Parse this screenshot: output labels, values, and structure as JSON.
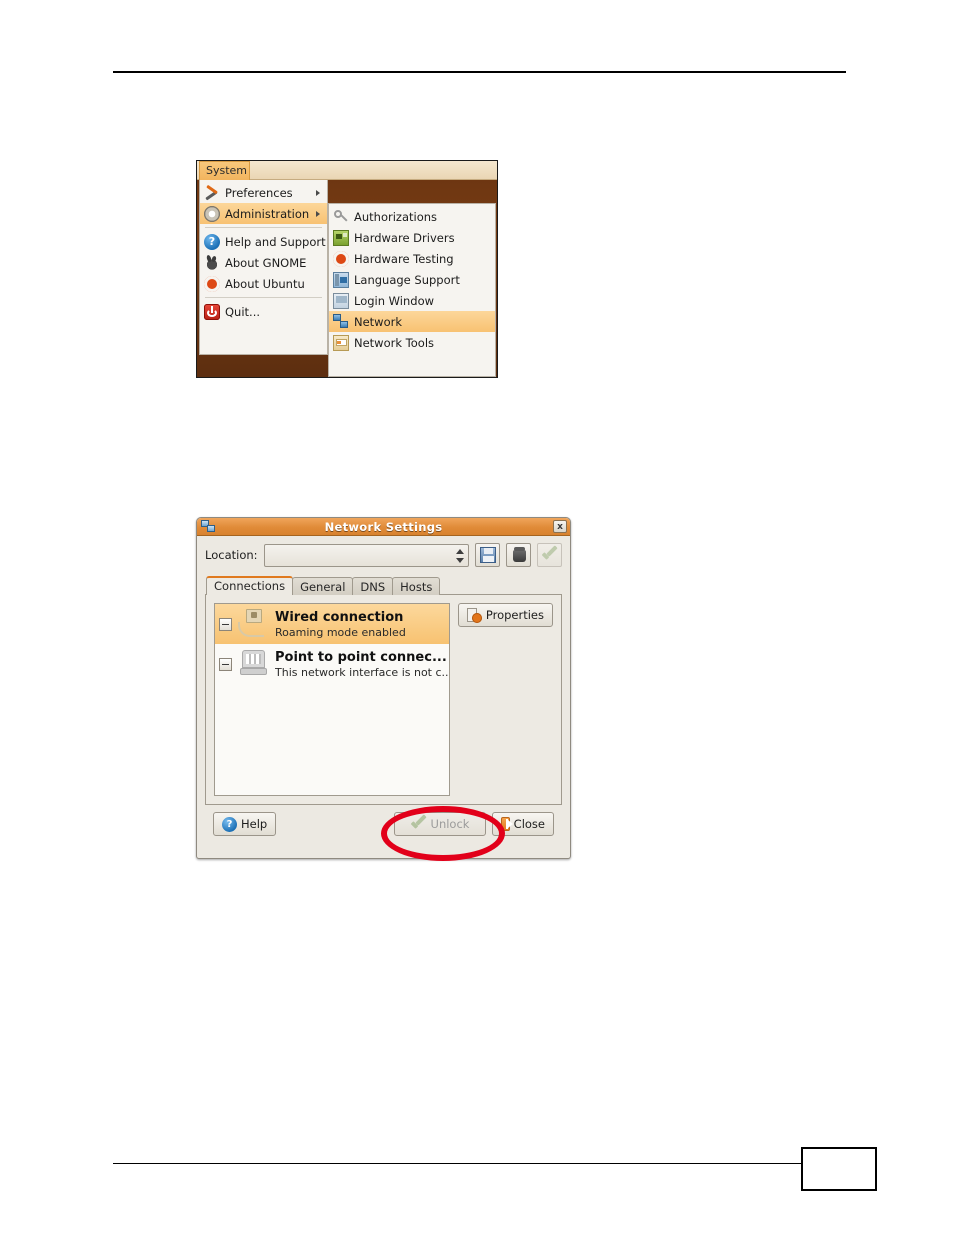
{
  "page": {
    "footer_page_number": ""
  },
  "system_menu": {
    "panel_button_label": "System",
    "primary_items": [
      {
        "label": "Preferences",
        "icon": "tools-icon",
        "has_submenu": true,
        "selected": false
      },
      {
        "label": "Administration",
        "icon": "gear-icon",
        "has_submenu": true,
        "selected": true
      },
      {
        "label": "Help and Support",
        "icon": "help-circle-icon",
        "has_submenu": false,
        "selected": false
      },
      {
        "label": "About GNOME",
        "icon": "gnome-foot-icon",
        "has_submenu": false,
        "selected": false
      },
      {
        "label": "About Ubuntu",
        "icon": "ubuntu-logo-icon",
        "has_submenu": false,
        "selected": false
      },
      {
        "label": "Quit...",
        "icon": "power-quit-icon",
        "has_submenu": false,
        "selected": false
      }
    ],
    "submenu_items": [
      {
        "label": "Authorizations",
        "icon": "key-icon",
        "selected": false
      },
      {
        "label": "Hardware Drivers",
        "icon": "hardware-drivers-icon",
        "selected": false
      },
      {
        "label": "Hardware Testing",
        "icon": "hardware-testing-icon",
        "selected": false
      },
      {
        "label": "Language Support",
        "icon": "language-support-icon",
        "selected": false
      },
      {
        "label": "Login Window",
        "icon": "login-window-icon",
        "selected": false
      },
      {
        "label": "Network",
        "icon": "network-icon",
        "selected": true
      },
      {
        "label": "Network Tools",
        "icon": "network-tools-icon",
        "selected": false
      }
    ]
  },
  "dialog": {
    "title": "Network Settings",
    "close_label": "x",
    "location": {
      "label": "Location:",
      "value": "",
      "placeholder": ""
    },
    "toolbar": [
      {
        "name": "save-location-button",
        "icon": "floppy-save-icon",
        "disabled": false
      },
      {
        "name": "delete-location-button",
        "icon": "trash-icon",
        "disabled": false
      },
      {
        "name": "apply-button",
        "icon": "check-icon",
        "disabled": true
      }
    ],
    "tabs": [
      {
        "label": "Connections",
        "active": true
      },
      {
        "label": "General",
        "active": false
      },
      {
        "label": "DNS",
        "active": false
      },
      {
        "label": "Hosts",
        "active": false
      }
    ],
    "connections": [
      {
        "title": "Wired connection",
        "subtitle": "Roaming mode enabled",
        "icon": "wired-connection-icon",
        "selected": true
      },
      {
        "title": "Point to point connec...",
        "subtitle": "This network interface is not c...",
        "icon": "modem-phone-icon",
        "selected": false
      }
    ],
    "properties_button": "Properties",
    "help_button": "Help",
    "unlock_button": "Unlock",
    "close_button": "Close"
  },
  "annotation": {
    "shape": "ellipse",
    "color": "#e2001a",
    "targets": "unlock-button"
  }
}
